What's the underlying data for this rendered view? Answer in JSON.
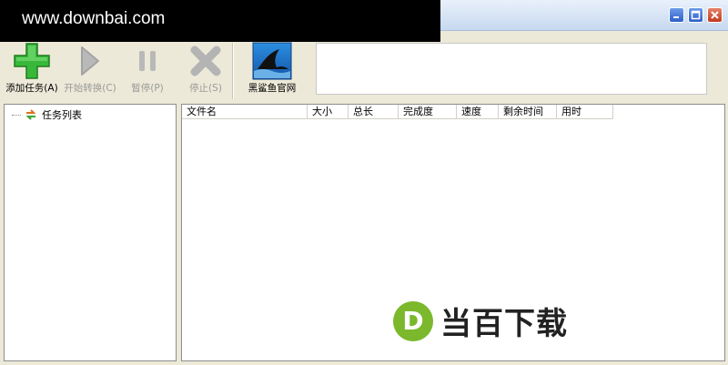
{
  "watermark": {
    "text": "www.downbai.com"
  },
  "toolbar": {
    "add": {
      "label": "添加任务(A)",
      "icon": "plus-icon"
    },
    "start": {
      "label": "开始转换(C)",
      "icon": "play-icon"
    },
    "pause": {
      "label": "暂停(P)",
      "icon": "pause-icon"
    },
    "stop": {
      "label": "停止(S)",
      "icon": "x-icon"
    },
    "website": {
      "label": "黑鲨鱼官网",
      "icon": "shark-fin-icon"
    }
  },
  "sidebar": {
    "tree_item": "任务列表",
    "icon": "refresh-arrows-icon"
  },
  "table": {
    "columns": [
      "文件名",
      "大小",
      "总长",
      "完成度",
      "速度",
      "剩余时间",
      "用时"
    ],
    "rows": []
  },
  "brand": {
    "letter": "D",
    "text": "当百下载",
    "color": "#7bb82c"
  }
}
